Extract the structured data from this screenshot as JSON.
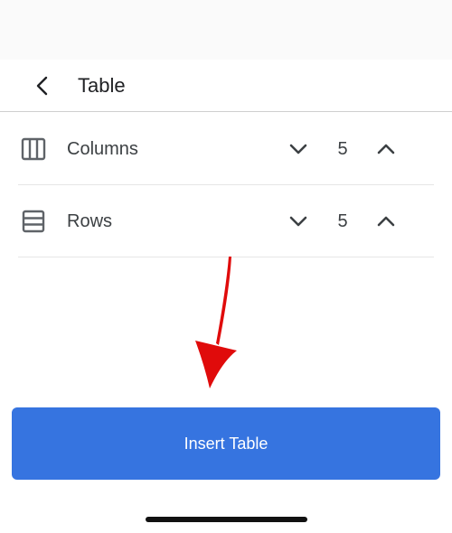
{
  "header": {
    "title": "Table",
    "back_icon": "chevron-left-icon"
  },
  "table_settings": {
    "columns": {
      "label": "Columns",
      "icon": "columns-icon",
      "value": "5"
    },
    "rows": {
      "label": "Rows",
      "icon": "rows-icon",
      "value": "5"
    }
  },
  "actions": {
    "insert_label": "Insert Table"
  },
  "colors": {
    "accent": "#3674e0",
    "annotation": "#e00b0b",
    "icon": "#5f6368"
  }
}
